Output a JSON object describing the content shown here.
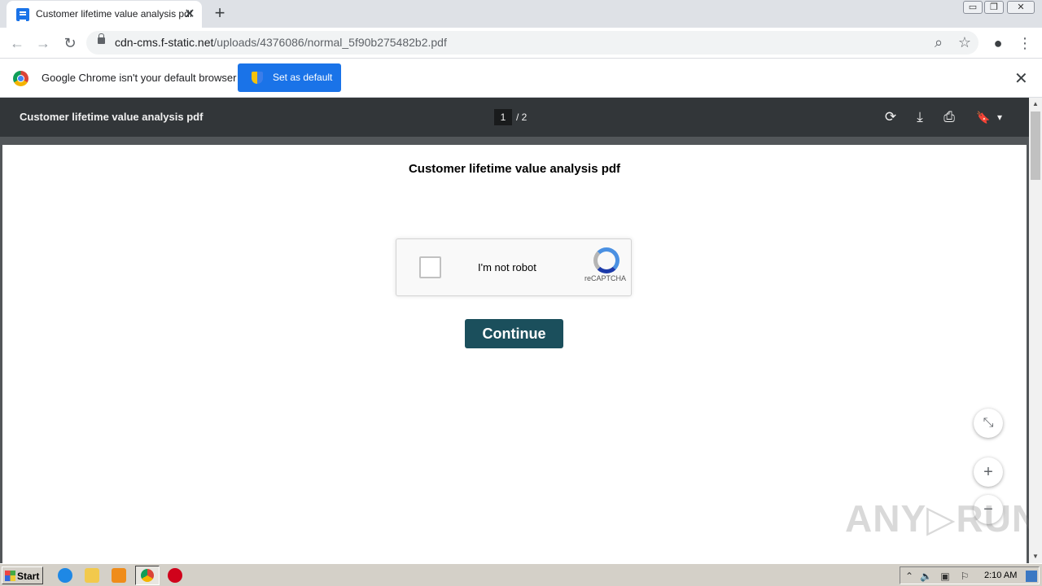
{
  "tab": {
    "title": "Customer lifetime value analysis pdf",
    "close_glyph": "✕",
    "new_tab_glyph": "+"
  },
  "window_controls": {
    "minimize": "▭",
    "restore": "❐",
    "close": "✕"
  },
  "toolbar": {
    "back_icon": "←",
    "forward_icon": "→",
    "reload_icon": "↻",
    "url_host": "cdn-cms.f-static.net",
    "url_path": "/uploads/4376086/normal_5f90b275482b2.pdf",
    "zoom_icon": "⌕",
    "bookmark_icon": "☆",
    "profile_icon": "●",
    "menu_icon": "⋮"
  },
  "infobar": {
    "message": "Google Chrome isn't your default browser",
    "button_label": "Set as default",
    "close_glyph": "✕"
  },
  "pdf_viewer": {
    "title": "Customer lifetime value analysis pdf",
    "current_page": "1",
    "total_pages": "/   2",
    "rotate_icon": "⟳",
    "download_icon": "⤓",
    "print_icon": "⎙",
    "bookmark_icon": "🔖",
    "dropdown_icon": "▾"
  },
  "document": {
    "title": "Customer lifetime value analysis pdf",
    "captcha_label": "I'm not robot",
    "captcha_brand": "reCAPTCHA",
    "continue_label": "Continue"
  },
  "fabs": {
    "fit_icon": "⤡",
    "zoom_in_icon": "+",
    "zoom_out_icon": "−"
  },
  "watermark": "ANY▷RUN",
  "taskbar": {
    "start_label": "Start",
    "clock": "2:10 AM",
    "colors": {
      "ie": "#1e88e5",
      "explorer": "#f2c94c",
      "media": "#ef8c1a",
      "chrome": "#4285f4",
      "opera": "#d0021b"
    }
  }
}
